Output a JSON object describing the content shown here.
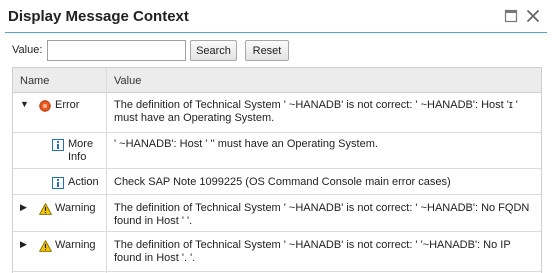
{
  "dialog": {
    "title": "Display Message Context",
    "maximize_icon": "maximize-icon",
    "close_icon": "close-icon"
  },
  "filter": {
    "label": "Value:",
    "input_value": "",
    "input_placeholder": "",
    "search_label": "Search",
    "reset_label": "Reset"
  },
  "table": {
    "columns": {
      "name": "Name",
      "value": "Value"
    },
    "rows": [
      {
        "toggle": "expanded",
        "icon": "error-icon",
        "name": "Error",
        "value": "The definition of Technical System '        ~HANADB' is not correct: '        ~HANADB': Host 'ɪ            ' must have an Operating System."
      },
      {
        "toggle": "none",
        "icon": "info-icon",
        "name": "More Info",
        "value": "'        ~HANADB': Host '             '' must have an Operating System."
      },
      {
        "toggle": "none",
        "icon": "info-icon",
        "name": "Action",
        "value": "Check SAP Note 1099225 (OS Command Console main error cases)"
      },
      {
        "toggle": "collapsed",
        "icon": "warning-icon",
        "name": "Warning",
        "value": "The definition of Technical System '        ~HANADB' is not correct: '        ~HANADB': No FQDN found in Host '            '."
      },
      {
        "toggle": "collapsed",
        "icon": "warning-icon",
        "name": "Warning",
        "value": "The definition of Technical System '        ~HANADB' is not correct: '        '~HANADB': No IP found in Host '.            '."
      }
    ]
  }
}
